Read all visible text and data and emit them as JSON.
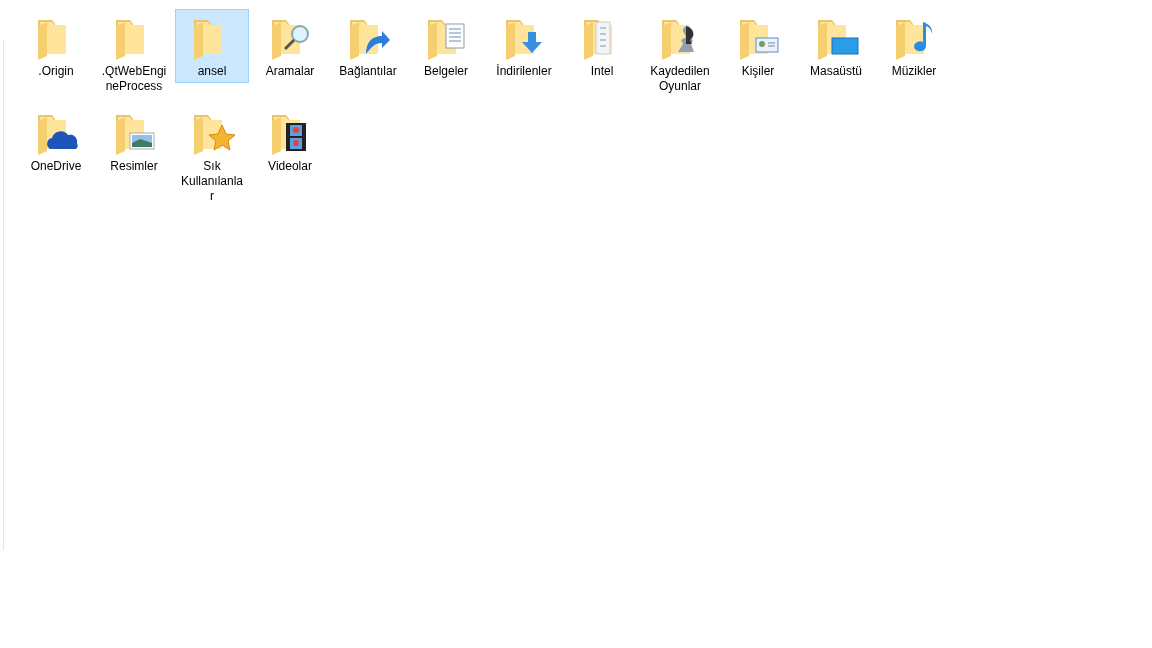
{
  "items": [
    {
      "label": ".Origin",
      "kind": "plain",
      "selected": false
    },
    {
      "label": ".QtWebEngineProcess",
      "kind": "plain",
      "selected": false
    },
    {
      "label": "ansel",
      "kind": "plain",
      "selected": true
    },
    {
      "label": "Aramalar",
      "kind": "search",
      "selected": false
    },
    {
      "label": "Bağlantılar",
      "kind": "link",
      "selected": false
    },
    {
      "label": "Belgeler",
      "kind": "document",
      "selected": false
    },
    {
      "label": "İndirilenler",
      "kind": "download",
      "selected": false
    },
    {
      "label": "Intel",
      "kind": "files",
      "selected": false
    },
    {
      "label": "Kaydedilen Oyunlar",
      "kind": "games",
      "selected": false
    },
    {
      "label": "Kişiler",
      "kind": "contacts",
      "selected": false
    },
    {
      "label": "Masaüstü",
      "kind": "desktop",
      "selected": false
    },
    {
      "label": "Müzikler",
      "kind": "music",
      "selected": false
    },
    {
      "label": "OneDrive",
      "kind": "cloud",
      "selected": false
    },
    {
      "label": "Resimler",
      "kind": "pictures",
      "selected": false
    },
    {
      "label": "Sık Kullanılanlar",
      "kind": "favorites",
      "selected": false
    },
    {
      "label": "Videolar",
      "kind": "videos",
      "selected": false
    }
  ]
}
